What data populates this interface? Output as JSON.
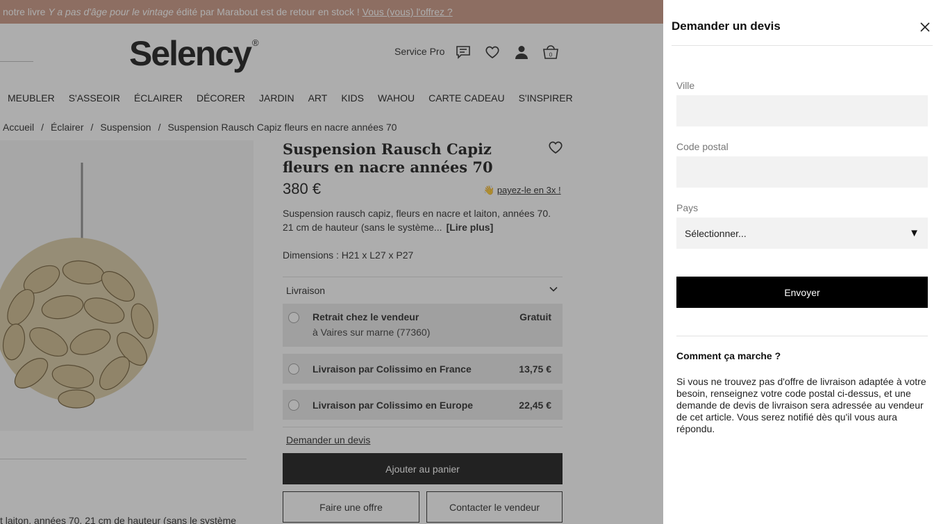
{
  "promo": {
    "prefix": "notre livre ",
    "book_title": "Y a pas d'âge pour le vintage",
    "middle": " édité par Marabout est de retour en stock ! ",
    "link": "Vous (vous) l'offrez ?"
  },
  "header": {
    "logo": "Selency",
    "logo_mark": "®",
    "service_pro": "Service Pro",
    "cart_count": "0"
  },
  "nav": [
    "MEUBLER",
    "S'ASSEOIR",
    "ÉCLAIRER",
    "DÉCORER",
    "JARDIN",
    "ART",
    "KIDS",
    "WAHOU",
    "CARTE CADEAU",
    "S'INSPIRER"
  ],
  "breadcrumb": [
    "Accueil",
    "Éclairer",
    "Suspension",
    "Suspension Rausch Capiz fleurs en nacre années 70"
  ],
  "breadcrumb_sep": "/",
  "product": {
    "title": "Suspension Rausch Capiz fleurs en nacre années 70",
    "price": "380 €",
    "pay_icon": "👋",
    "pay_link": "payez-le en 3x !",
    "description": "Suspension rausch capiz, fleurs en nacre et laiton, années 70. 21 cm de hauteur (sans le système...",
    "read_more": "[Lire plus]",
    "dimensions": "Dimensions : H21 x L27 x P27",
    "bottom_description": "t laiton, années 70. 21 cm de hauteur (sans le système"
  },
  "shipping": {
    "title": "Livraison",
    "options": [
      {
        "label": "Retrait chez le vendeur",
        "sub": "à Vaires sur marne (77360)",
        "price": "Gratuit"
      },
      {
        "label": "Livraison par Colissimo en France",
        "sub": "",
        "price": "13,75 €"
      },
      {
        "label": "Livraison par Colissimo en Europe",
        "sub": "",
        "price": "22,45 €"
      }
    ],
    "quote_link": "Demander un devis"
  },
  "actions": {
    "add_to_cart": "Ajouter au panier",
    "make_offer": "Faire une offre",
    "contact_seller": "Contacter le vendeur"
  },
  "panel": {
    "title": "Demander un devis",
    "city_label": "Ville",
    "city_value": "",
    "postal_label": "Code postal",
    "postal_value": "",
    "country_label": "Pays",
    "country_value": "Sélectionner...",
    "send": "Envoyer",
    "how_title": "Comment ça marche ?",
    "how_text": "Si vous ne trouvez pas d'offre de livraison adaptée à votre besoin, renseignez votre code postal ci-dessus, et une demande de devis de livraison sera adressée au vendeur de cet article. Vous serez notifié dès qu'il vous aura répondu."
  },
  "colors": {
    "promo_bg": "#c9937e",
    "button_black": "#000000",
    "input_bg": "#f2f2f2"
  }
}
